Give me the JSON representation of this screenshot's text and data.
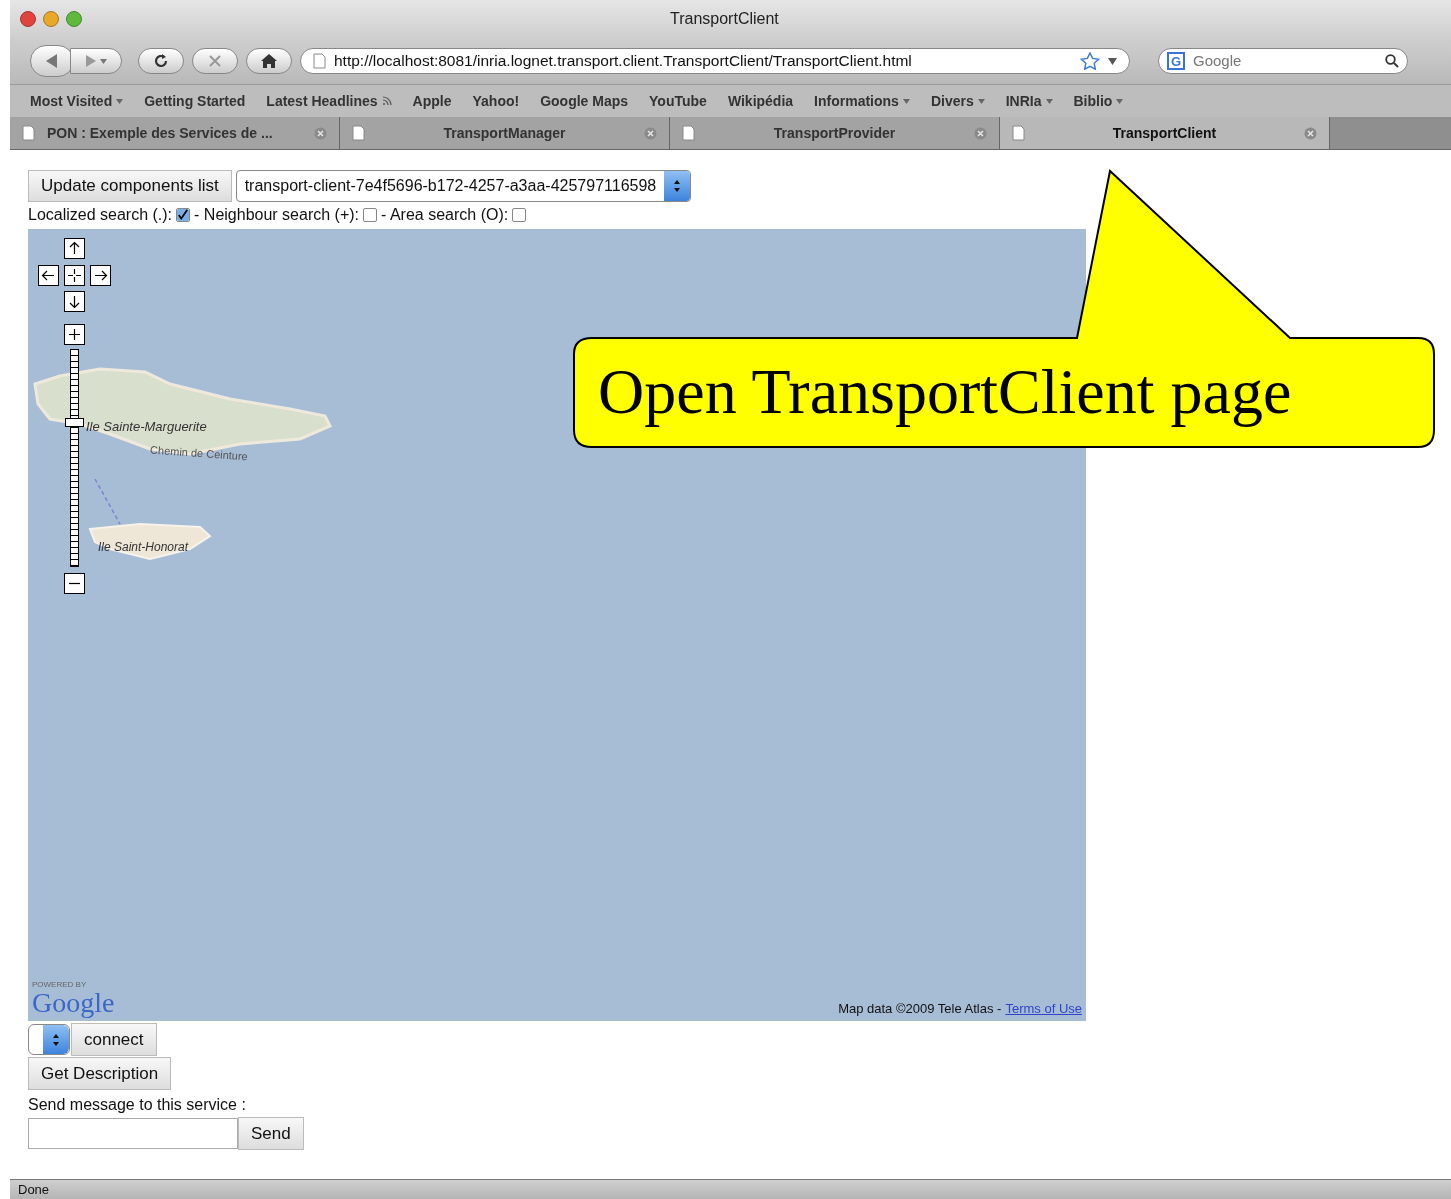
{
  "window": {
    "title": "TransportClient"
  },
  "toolbar": {
    "url": "http://localhost:8081/inria.lognet.transport.client.TransportClient/TransportClient.html",
    "search_placeholder": "Google",
    "engine_icon": "G"
  },
  "bookmarks": [
    {
      "label": "Most Visited",
      "menu": true,
      "feed": false
    },
    {
      "label": "Getting Started",
      "menu": false,
      "feed": false
    },
    {
      "label": "Latest Headlines",
      "menu": false,
      "feed": true
    },
    {
      "label": "Apple",
      "menu": false,
      "feed": false
    },
    {
      "label": "Yahoo!",
      "menu": false,
      "feed": false
    },
    {
      "label": "Google Maps",
      "menu": false,
      "feed": false
    },
    {
      "label": "YouTube",
      "menu": false,
      "feed": false
    },
    {
      "label": "Wikipédia",
      "menu": false,
      "feed": false
    },
    {
      "label": "Informations",
      "menu": true,
      "feed": false
    },
    {
      "label": "Divers",
      "menu": true,
      "feed": false
    },
    {
      "label": "INRIa",
      "menu": true,
      "feed": false
    },
    {
      "label": "Biblio",
      "menu": true,
      "feed": false
    }
  ],
  "tabs": [
    {
      "label": "PON : Exemple des Services de ...",
      "selected": false
    },
    {
      "label": "TransportManager",
      "selected": false
    },
    {
      "label": "TransportProvider",
      "selected": false
    },
    {
      "label": "TransportClient",
      "selected": true
    }
  ],
  "page": {
    "update_button": "Update components list",
    "component_select": "transport-client-7e4f5696-b172-4257-a3aa-425797116598",
    "search_options": [
      {
        "label": "Localized search (.):",
        "checked": true
      },
      {
        "label": "- Neighbour search (+):",
        "checked": false
      },
      {
        "label": "- Area search (O):",
        "checked": false
      }
    ],
    "map": {
      "labels": [
        "Ile Sainte-Marguerite",
        "Chemin de Ceinture",
        "Ile Saint-Honorat"
      ],
      "zoom": {
        "level": 0.67
      },
      "powered_by": "POWERED BY",
      "logo": "Google",
      "attribution": "Map data ©2009 Tele Atlas -",
      "terms_link": "Terms of Use"
    },
    "connect_button": "connect",
    "describe_button": "Get Description",
    "message_label": "Send message to this service :",
    "send_button": "Send"
  },
  "callout": {
    "text": "Open TransportClient page"
  },
  "status_bar": {
    "text": "Done"
  }
}
